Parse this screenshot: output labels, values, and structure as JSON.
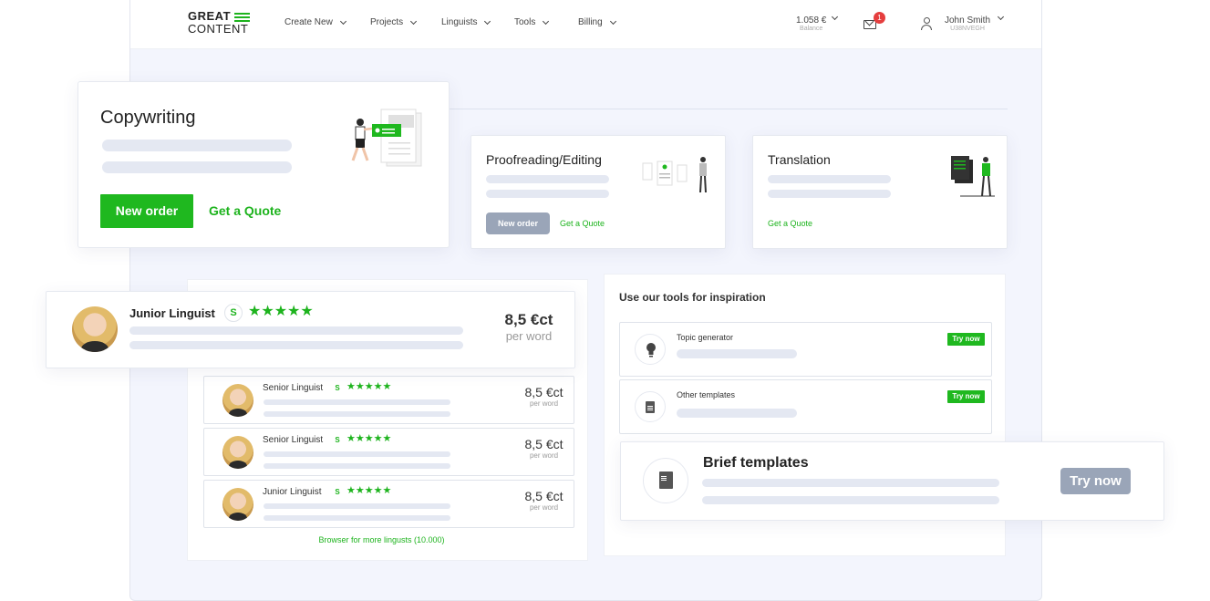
{
  "header": {
    "logo_line1": "GREAT",
    "logo_line2": "CONTENT",
    "nav": [
      "Create New",
      "Projects",
      "Linguists",
      "Tools",
      "Billing"
    ],
    "balance_value": "1.058 €",
    "balance_label": "Balance",
    "notifications_count": "1",
    "user_name": "John Smith",
    "user_id": "U38NVEGH"
  },
  "services": {
    "copywriting": {
      "title": "Copywriting",
      "new_order": "New order",
      "quote": "Get a Quote"
    },
    "proofreading": {
      "title": "Proofreading/Editing",
      "new_order": "New order",
      "quote": "Get a Quote"
    },
    "translation": {
      "title": "Translation",
      "quote": "Get a Quote"
    }
  },
  "featured_linguist": {
    "name": "Junior Linguist",
    "level": "S",
    "stars": "★★★★★",
    "price": "8,5 €ct",
    "unit": "per word"
  },
  "linguists": [
    {
      "name": "Senior Linguist",
      "level": "S",
      "stars": "★★★★★",
      "price": "8,5 €ct",
      "unit": "per word"
    },
    {
      "name": "Senior Linguist",
      "level": "S",
      "stars": "★★★★★",
      "price": "8,5 €ct",
      "unit": "per word"
    },
    {
      "name": "Junior Linguist",
      "level": "S",
      "stars": "★★★★★",
      "price": "8,5 €ct",
      "unit": "per word"
    }
  ],
  "browse_more": "Browser for more lingusts (10.000)",
  "tools": {
    "title": "Use our tools for inspiration",
    "items": [
      {
        "name": "Topic generator",
        "cta": "Try now",
        "icon": "lightbulb-icon"
      },
      {
        "name": "Other templates",
        "cta": "Try now",
        "icon": "document-icon"
      }
    ],
    "brief": {
      "name": "Brief templates",
      "cta": "Try now",
      "icon": "document-icon"
    }
  },
  "colors": {
    "accent": "#1fb81f",
    "muted_button": "#9aa5b8",
    "badge": "#e53e3e",
    "background": "#f3f5fd"
  }
}
